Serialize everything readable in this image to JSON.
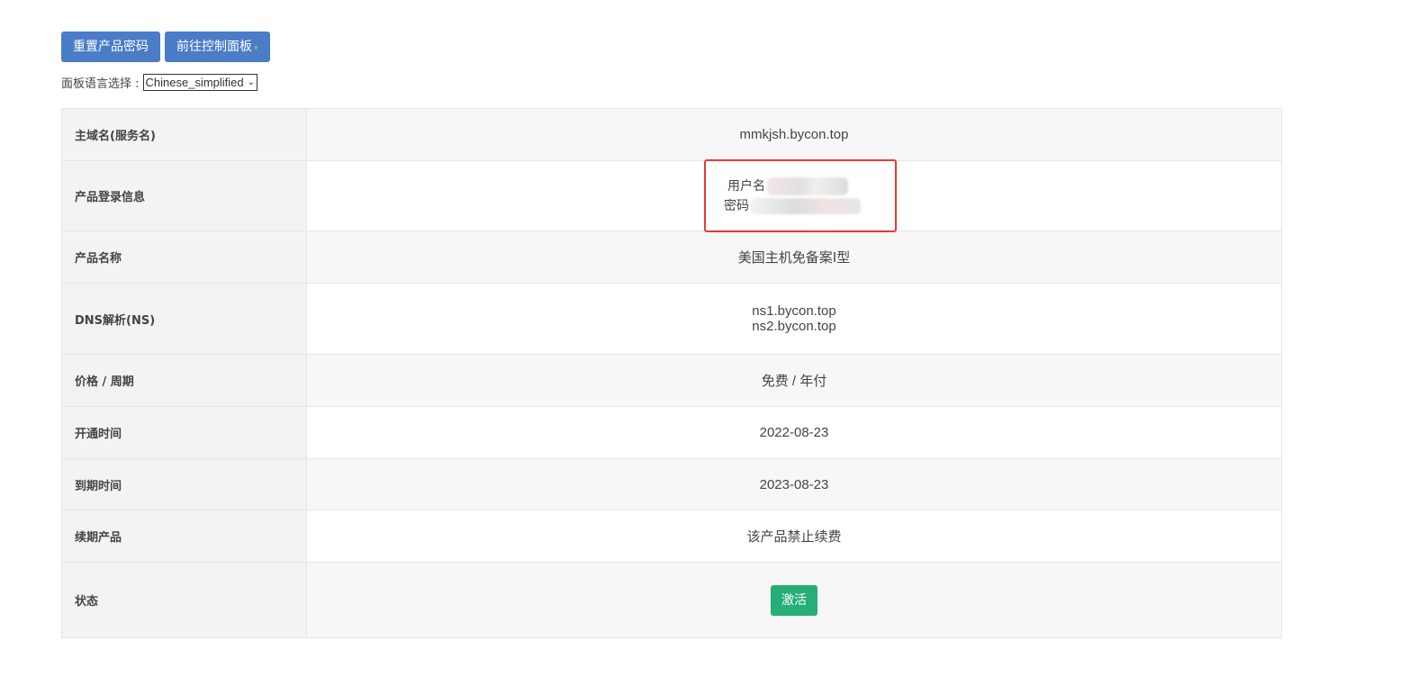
{
  "toolbar": {
    "reset_password_label": "重置产品密码",
    "control_panel_label": "前往控制面板"
  },
  "language": {
    "label": "面板语言选择 :",
    "selected": "Chinese_simplified"
  },
  "details": {
    "rows": [
      {
        "label": "主域名(服务名)",
        "value": "mmkjsh.bycon.top"
      },
      {
        "label": "产品登录信息",
        "username_label": "用户名",
        "password_label": "密码"
      },
      {
        "label": "产品名称",
        "value": "美国主机免备案Ⅰ型"
      },
      {
        "label": "DNS解析(NS)",
        "ns1": "ns1.bycon.top",
        "ns2": "ns2.bycon.top"
      },
      {
        "label": "价格 / 周期",
        "value": "免费 / 年付"
      },
      {
        "label": "开通时间",
        "value": "2022-08-23"
      },
      {
        "label": "到期时间",
        "value": "2023-08-23"
      },
      {
        "label": "续期产品",
        "value": "该产品禁止续费"
      },
      {
        "label": "状态",
        "value": "激活"
      }
    ]
  },
  "colors": {
    "button": "#4a7cc7",
    "status_active": "#27ae78",
    "highlight_box": "#e53935"
  }
}
